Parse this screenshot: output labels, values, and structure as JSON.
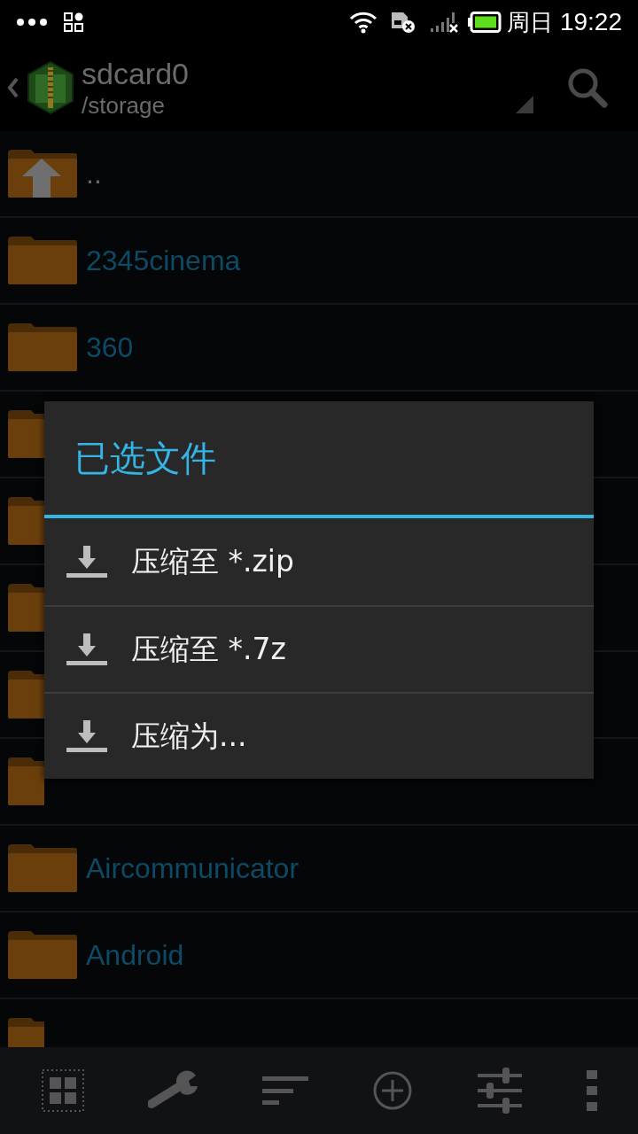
{
  "status_bar": {
    "day": "周日",
    "time": "19:22"
  },
  "header": {
    "title": "sdcard0",
    "path": "/storage"
  },
  "files": [
    {
      "kind": "up",
      "name": ".."
    },
    {
      "kind": "folder",
      "name": "2345cinema"
    },
    {
      "kind": "folder",
      "name": "360"
    },
    {
      "kind": "folder"
    },
    {
      "kind": "folder"
    },
    {
      "kind": "folder"
    },
    {
      "kind": "folder"
    },
    {
      "kind": "folder"
    },
    {
      "kind": "folder",
      "name": "Aircommunicator"
    },
    {
      "kind": "folder",
      "name": "Android"
    },
    {
      "kind": "folder"
    }
  ],
  "dialog": {
    "title": "已选文件",
    "items": [
      {
        "label": "压缩至 *.zip"
      },
      {
        "label": "压缩至 *.7z"
      },
      {
        "label": "压缩为..."
      }
    ]
  }
}
